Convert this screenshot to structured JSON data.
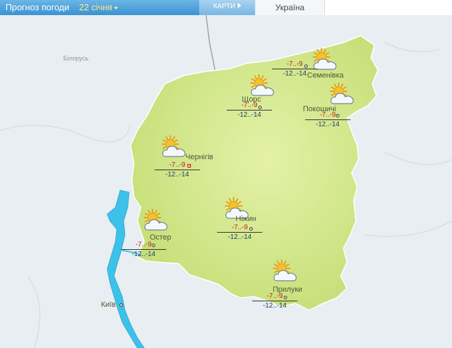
{
  "header": {
    "title": "Прогноз погоди",
    "date": "22 січня",
    "maps_tab": "КАРТИ",
    "region_tab": "Україна"
  },
  "map": {
    "countries": [
      "Білорусь"
    ],
    "cities": [
      {
        "name": "Чернігів",
        "day": "-7..-9",
        "night": "-12..-14",
        "icon": "sun-behind-cloud-icon",
        "capital": true
      },
      {
        "name": "Семенівка",
        "day": "-7..-9",
        "night": "-12..-14",
        "icon": "sun-behind-cloud-icon"
      },
      {
        "name": "Щорс",
        "day": "-7..-9",
        "night": "-12..-14",
        "icon": "sun-behind-cloud-icon"
      },
      {
        "name": "Покошичі",
        "day": "-7..-9",
        "night": "-12..-14",
        "icon": "sun-behind-cloud-icon"
      },
      {
        "name": "Ніжин",
        "day": "-7..-9",
        "night": "-12..-14",
        "icon": "sun-behind-cloud-icon"
      },
      {
        "name": "Остер",
        "day": "-7..-9",
        "night": "-12..-14",
        "icon": "sun-behind-cloud-icon"
      },
      {
        "name": "Прилуки",
        "day": "-7..-9",
        "night": "-12..-14",
        "icon": "sun-behind-cloud-icon"
      },
      {
        "name": "Київ",
        "icon": "none"
      }
    ],
    "colors": {
      "region_fill": "#c8e07a",
      "region_center": "#e2f0a6",
      "water": "#3ec1e8",
      "background": "#e8eef1"
    }
  }
}
